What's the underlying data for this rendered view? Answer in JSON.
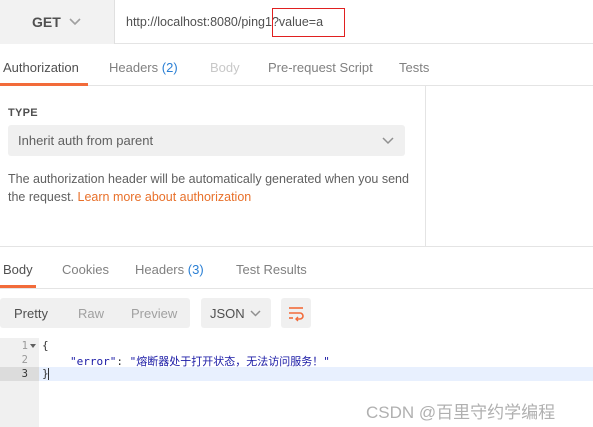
{
  "request": {
    "method": "GET",
    "url": "http://localhost:8080/ping1?value=a"
  },
  "request_tabs": [
    {
      "label": "Authorization",
      "count": ""
    },
    {
      "label": "Headers",
      "count": "(2)"
    },
    {
      "label": "Body",
      "count": ""
    },
    {
      "label": "Pre-request Script",
      "count": ""
    },
    {
      "label": "Tests",
      "count": ""
    }
  ],
  "auth": {
    "type_label": "TYPE",
    "selected": "Inherit auth from parent",
    "description": "The authorization header will be automatically generated when you send the request.",
    "link": "Learn more about authorization"
  },
  "response_tabs": [
    {
      "label": "Body",
      "count": ""
    },
    {
      "label": "Cookies",
      "count": ""
    },
    {
      "label": "Headers",
      "count": "(3)"
    },
    {
      "label": "Test Results",
      "count": ""
    }
  ],
  "response_toolbar": {
    "views": [
      "Pretty",
      "Raw",
      "Preview"
    ],
    "active_view": "Pretty",
    "format": "JSON"
  },
  "code": {
    "line_numbers": [
      "1",
      "2",
      "3"
    ],
    "line1": "{",
    "key": "\"error\"",
    "colon": ": ",
    "value": "\"熔断器处于打开状态，无法访问服务！\"",
    "line3": "}"
  },
  "watermark": "CSDN @百里守约学编程",
  "colors": {
    "accent": "#f26b3a",
    "link": "#e8702a",
    "count": "#2a7fd4",
    "highlight_box": "#e02020"
  }
}
